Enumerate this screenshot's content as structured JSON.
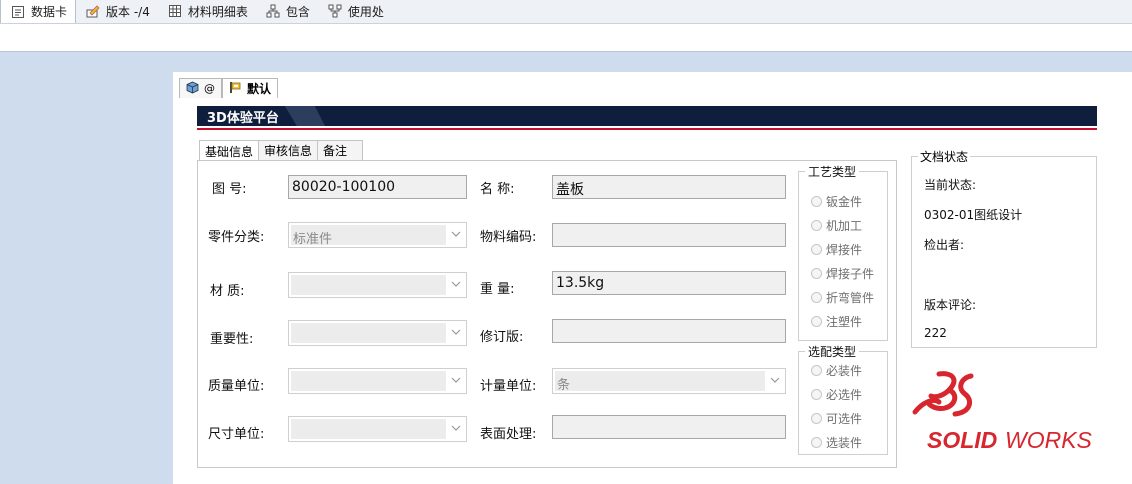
{
  "top_tabs": [
    {
      "label": "数据卡",
      "icon": "data-card-icon"
    },
    {
      "label": "版本 -/4",
      "icon": "version-icon"
    },
    {
      "label": "材料明细表",
      "icon": "bom-table-icon"
    },
    {
      "label": "包含",
      "icon": "contains-icon"
    },
    {
      "label": "使用处",
      "icon": "where-used-icon"
    }
  ],
  "sub_tabs": [
    {
      "label": "@",
      "icon": "cube-icon"
    },
    {
      "label": "默认",
      "icon": "configuration-icon"
    }
  ],
  "banner": {
    "title": "3D体验平台"
  },
  "form_tabs": [
    "基础信息",
    "审核信息",
    "备注"
  ],
  "form": {
    "drawing_no_label": "图 号:",
    "drawing_no_value": "80020-100100",
    "name_label": "名 称:",
    "name_value": "盖板",
    "part_category_label": "零件分类:",
    "part_category_value": "标准件",
    "material_code_label": "物料编码:",
    "material_code_value": "",
    "material_label": "材 质:",
    "material_value": "",
    "weight_label": "重 量:",
    "weight_value": "13.5kg",
    "importance_label": "重要性:",
    "importance_value": "",
    "revision_label": "修订版:",
    "revision_value": "",
    "mass_unit_label": "质量单位:",
    "mass_unit_value": "",
    "measure_unit_label": "计量单位:",
    "measure_unit_value": "条",
    "size_unit_label": "尺寸单位:",
    "size_unit_value": "",
    "surface_label": "表面处理:",
    "surface_value": ""
  },
  "process_group": {
    "title": "工艺类型",
    "options": [
      "钣金件",
      "机加工",
      "焊接件",
      "焊接子件",
      "折弯管件",
      "注塑件"
    ]
  },
  "assembly_group": {
    "title": "选配类型",
    "options": [
      "必装件",
      "必选件",
      "可选件",
      "选装件"
    ]
  },
  "doc_status": {
    "title": "文档状态",
    "current_state_label": "当前状态:",
    "current_state_value": "0302-01图纸设计",
    "checked_out_label": "检出者:",
    "checked_out_value": "",
    "version_comment_label": "版本评论:",
    "version_comment_value": "222"
  },
  "logo": {
    "text_bold": "SOLID",
    "text_rest": "WORKS",
    "color": "#d8262e"
  },
  "colors": {
    "banner": "#0f1e3c",
    "accent_red": "#c8102e",
    "background": "#cfdcee"
  }
}
